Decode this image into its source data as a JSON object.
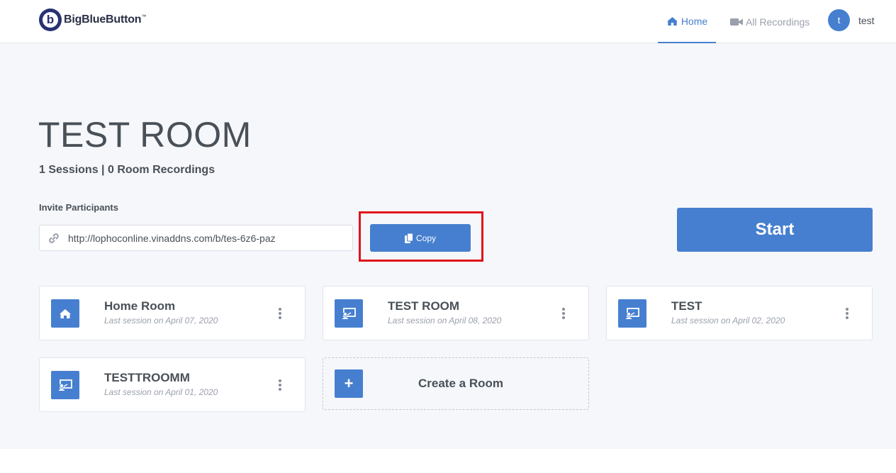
{
  "header": {
    "brand": "BigBlueButton",
    "brand_tm": "™",
    "nav_home": "Home",
    "nav_recordings": "All Recordings",
    "user_initial": "t",
    "user_name": "test"
  },
  "room": {
    "title": "TEST ROOM",
    "stats": "1 Sessions | 0 Room Recordings",
    "invite_label": "Invite Participants",
    "invite_url": "http://lophoconline.vinaddns.com/b/tes-6z6-paz",
    "copy_label": "Copy",
    "start_label": "Start"
  },
  "rooms": [
    {
      "name": "Home Room",
      "last_session": "Last session on April 07, 2020",
      "icon": "home-icon"
    },
    {
      "name": "TEST ROOM",
      "last_session": "Last session on April 08, 2020",
      "icon": "presenter-icon"
    },
    {
      "name": "TEST",
      "last_session": "Last session on April 02, 2020",
      "icon": "presenter-icon"
    },
    {
      "name": "TESTTROOMM",
      "last_session": "Last session on April 01, 2020",
      "icon": "presenter-icon"
    }
  ],
  "create_room": {
    "label": "Create a Room",
    "icon_glyph": "+"
  },
  "colors": {
    "accent": "#467fcf",
    "highlight": "#e0141c",
    "background": "#f5f7fb"
  }
}
